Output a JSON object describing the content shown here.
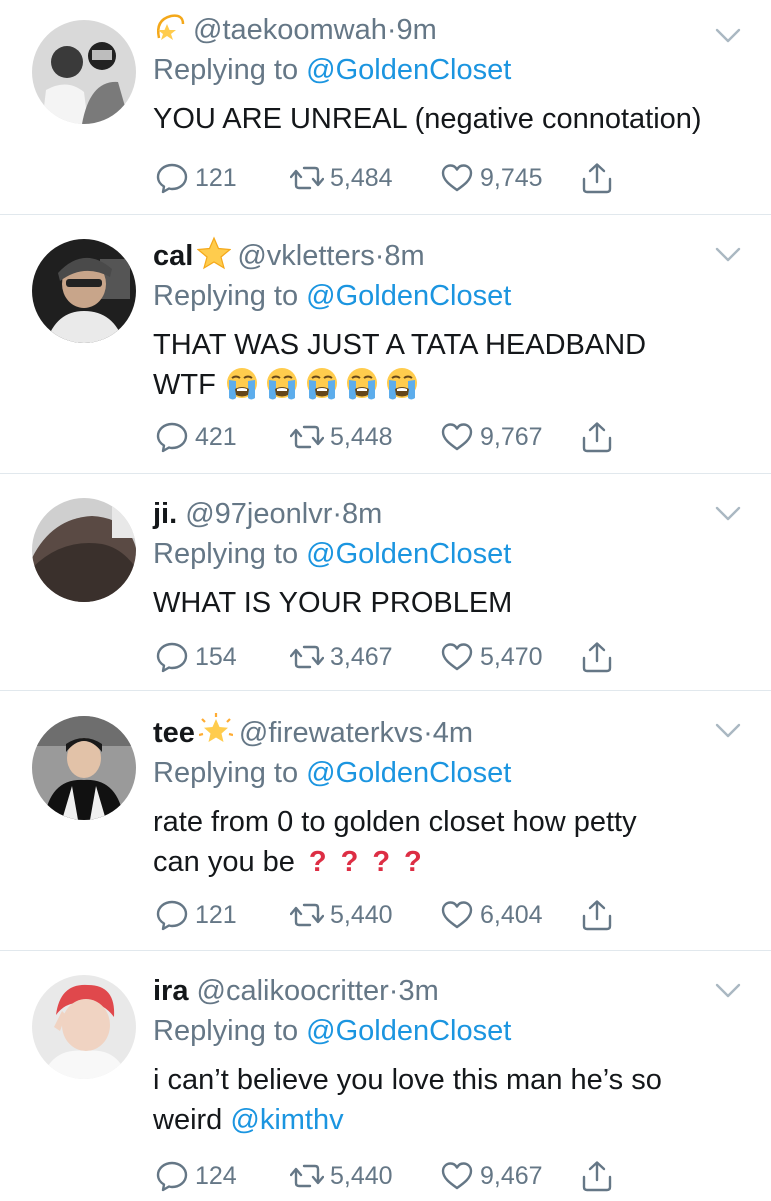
{
  "tweets": [
    {
      "name": "",
      "badge": "dizzy-star",
      "handle": "@taekoomwah",
      "dot": "·",
      "time": "9m",
      "replying_prefix": "Replying to",
      "replying_to": "@GoldenCloset",
      "text_lines": [
        "YOU ARE UNREAL (negative connotation)"
      ],
      "emoji": [],
      "questions": [],
      "trailing_mention": "",
      "replies": "121",
      "retweets": "5,484",
      "likes": "9,745"
    },
    {
      "name": "cal",
      "badge": "star",
      "handle": "@vkletters",
      "dot": "·",
      "time": "8m",
      "replying_prefix": "Replying to",
      "replying_to": "@GoldenCloset",
      "text_lines": [
        "THAT WAS JUST A TATA HEADBAND",
        "WTF"
      ],
      "emoji": [
        "loudly-crying-face",
        "loudly-crying-face",
        "loudly-crying-face",
        "loudly-crying-face",
        "loudly-crying-face"
      ],
      "questions": [],
      "trailing_mention": "",
      "replies": "421",
      "retweets": "5,448",
      "likes": "9,767"
    },
    {
      "name": "ji.",
      "badge": "",
      "handle": "@97jeonlvr",
      "dot": "·",
      "time": "8m",
      "replying_prefix": "Replying to",
      "replying_to": "@GoldenCloset",
      "text_lines": [
        "WHAT IS YOUR PROBLEM"
      ],
      "emoji": [],
      "questions": [],
      "trailing_mention": "",
      "replies": "154",
      "retweets": "3,467",
      "likes": "5,470"
    },
    {
      "name": "tee",
      "badge": "glowing-star",
      "handle": "@firewaterkvs",
      "dot": "·",
      "time": "4m",
      "replying_prefix": "Replying to",
      "replying_to": "@GoldenCloset",
      "text_lines": [
        "rate from 0 to golden closet how petty",
        "can you be"
      ],
      "emoji": [],
      "questions": [
        "?",
        "?",
        "?",
        "?"
      ],
      "trailing_mention": "",
      "replies": "121",
      "retweets": "5,440",
      "likes": "6,404"
    },
    {
      "name": "ira",
      "badge": "",
      "handle": "@calikoocritter",
      "dot": "·",
      "time": "3m",
      "replying_prefix": "Replying to",
      "replying_to": "@GoldenCloset",
      "text_lines": [
        "i can’t believe you love this man he’s so",
        "weird"
      ],
      "emoji": [],
      "questions": [],
      "trailing_mention": "@kimthv",
      "replies": "124",
      "retweets": "5,440",
      "likes": "9,467"
    }
  ],
  "colors": {
    "link": "#1b95e0",
    "secondary": "#657786",
    "divider": "#e1e8ed",
    "text": "#14171a"
  },
  "icons": {
    "reply": "reply-bubble-icon",
    "retweet": "retweet-icon",
    "like": "heart-icon",
    "share": "share-icon",
    "more": "chevron-down-icon"
  }
}
